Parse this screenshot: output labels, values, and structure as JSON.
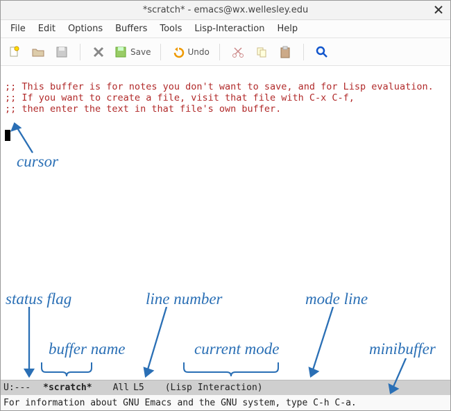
{
  "title": "*scratch* - emacs@wx.wellesley.edu",
  "menubar": [
    "File",
    "Edit",
    "Options",
    "Buffers",
    "Tools",
    "Lisp-Interaction",
    "Help"
  ],
  "toolbar": {
    "save_label": "Save",
    "undo_label": "Undo"
  },
  "buffer": {
    "line1": ";; This buffer is for notes you don't want to save, and for Lisp evaluation.",
    "line2": ";; If you want to create a file, visit that file with C-x C-f,",
    "line3": ";; then enter the text in that file's own buffer."
  },
  "modeline": {
    "status": "U:---",
    "buffer_name": "*scratch*",
    "position": "All",
    "line": "L5",
    "mode": "(Lisp Interaction)"
  },
  "minibuffer": "For information about GNU Emacs and the GNU system, type C-h C-a.",
  "annotations": {
    "cursor": "cursor",
    "status_flag": "status flag",
    "buffer_name": "buffer name",
    "line_number": "line number",
    "current_mode": "current mode",
    "mode_line": "mode line",
    "minibuffer": "minibuffer"
  }
}
